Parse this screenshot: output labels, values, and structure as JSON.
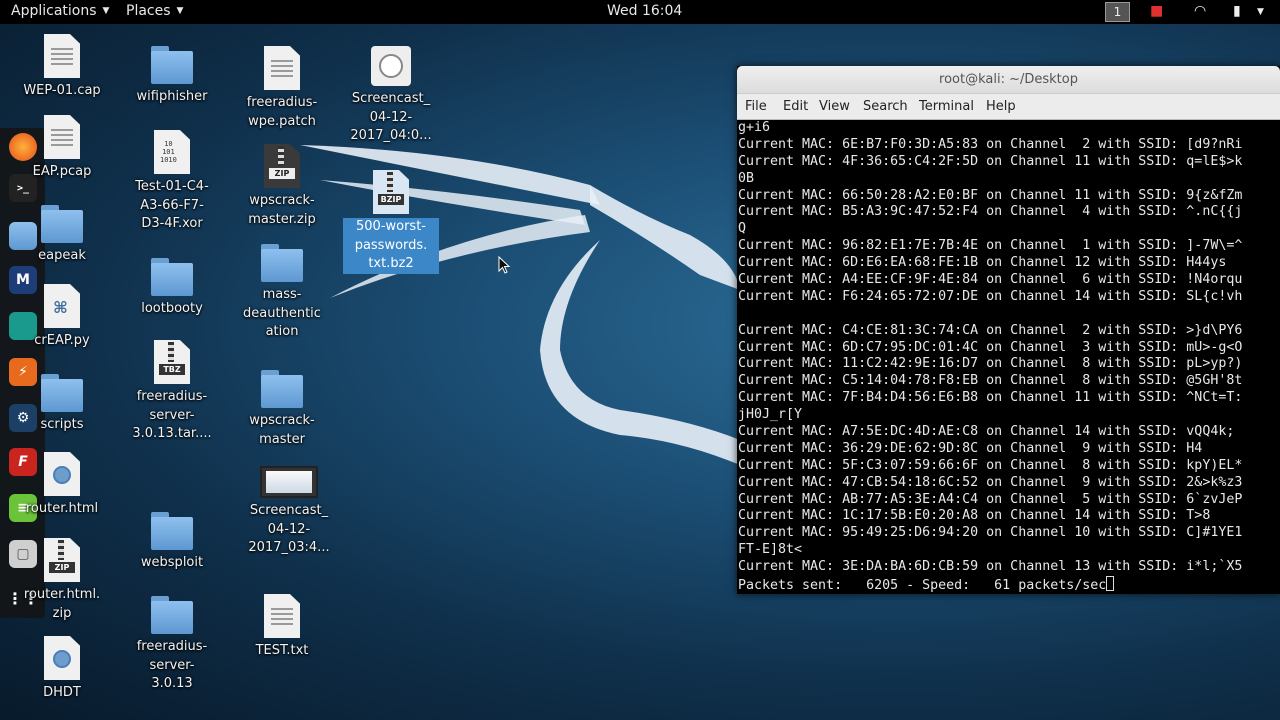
{
  "topbar": {
    "applications": "Applications",
    "places": "Places",
    "clock": "Wed 16:04",
    "workspace": "1"
  },
  "desktop_icons": [
    {
      "name": "wep01",
      "label": "WEP-01.cap"
    },
    {
      "name": "wifiphisher",
      "label": "wifiphisher"
    },
    {
      "name": "freeradius-patch",
      "label": "freeradius-\nwpe.patch"
    },
    {
      "name": "screencast1",
      "label": "Screencast_\n04-12-\n2017_04:0..."
    },
    {
      "name": "eap-pcap",
      "label": "EAP.pcap"
    },
    {
      "name": "test-xor",
      "label": "Test-01-C4-\nA3-66-F7-\nD3-4F.xor"
    },
    {
      "name": "wpscrack-zip",
      "label": "wpscrack-\nmaster.zip"
    },
    {
      "name": "passwords-bz2",
      "label": "500-worst-\npasswords.\ntxt.bz2"
    },
    {
      "name": "eapeak",
      "label": "eapeak"
    },
    {
      "name": "lootbooty",
      "label": "lootbooty"
    },
    {
      "name": "mass-deauth",
      "label": "mass-\ndeauthentic\nation"
    },
    {
      "name": "crEAP",
      "label": "crEAP.py"
    },
    {
      "name": "freeradius-tar",
      "label": "freeradius-\nserver-\n3.0.13.tar...."
    },
    {
      "name": "scripts",
      "label": "scripts"
    },
    {
      "name": "wpscrack-master",
      "label": "wpscrack-\nmaster"
    },
    {
      "name": "router-html",
      "label": "router.html"
    },
    {
      "name": "screencast2",
      "label": "Screencast_\n04-12-\n2017_03:4..."
    },
    {
      "name": "websploit",
      "label": "websploit"
    },
    {
      "name": "router-zip",
      "label": "router.html.\nzip"
    },
    {
      "name": "freeradius-server",
      "label": "freeradius-\nserver-\n3.0.13"
    },
    {
      "name": "test-txt",
      "label": "TEST.txt"
    },
    {
      "name": "dhdt",
      "label": "DHDT"
    }
  ],
  "terminal": {
    "title": "root@kali: ~/Desktop",
    "menu": [
      "File",
      "Edit",
      "View",
      "Search",
      "Terminal",
      "Help"
    ],
    "lines": [
      "g+i6",
      "Current MAC: 6E:B7:F0:3D:A5:83 on Channel  2 with SSID: [d9?nRi",
      "Current MAC: 4F:36:65:C4:2F:5D on Channel 11 with SSID: q=lE$>k",
      "0B",
      "Current MAC: 66:50:28:A2:E0:BF on Channel 11 with SSID: 9{z&fZm",
      "Current MAC: B5:A3:9C:47:52:F4 on Channel  4 with SSID: ^.nC{{j",
      "Q",
      "Current MAC: 96:82:E1:7E:7B:4E on Channel  1 with SSID: ]-7W\\=^",
      "Current MAC: 6D:E6:EA:68:FE:1B on Channel 12 with SSID: H44ys",
      "Current MAC: A4:EE:CF:9F:4E:84 on Channel  6 with SSID: !N4orqu",
      "Current MAC: F6:24:65:72:07:DE on Channel 14 with SSID: SL{c!vh",
      "",
      "Current MAC: C4:CE:81:3C:74:CA on Channel  2 with SSID: >}d\\PY6",
      "Current MAC: 6D:C7:95:DC:01:4C on Channel  3 with SSID: mU>-g<O",
      "Current MAC: 11:C2:42:9E:16:D7 on Channel  8 with SSID: pL>yp?)",
      "Current MAC: C5:14:04:78:F8:EB on Channel  8 with SSID: @5GH'8t",
      "Current MAC: 7F:B4:D4:56:E6:B8 on Channel 11 with SSID: ^NCt=T:",
      "jH0J_r[Y",
      "Current MAC: A7:5E:DC:4D:AE:C8 on Channel 14 with SSID: vQQ4k; ",
      "Current MAC: 36:29:DE:62:9D:8C on Channel  9 with SSID: H4",
      "Current MAC: 5F:C3:07:59:66:6F on Channel  8 with SSID: kpY)EL*",
      "Current MAC: 47:CB:54:18:6C:52 on Channel  9 with SSID: 2&>k%z3",
      "Current MAC: AB:77:A5:3E:A4:C4 on Channel  5 with SSID: 6`zvJeP",
      "Current MAC: 1C:17:5B:E0:20:A8 on Channel 14 with SSID: T>8",
      "Current MAC: 95:49:25:D6:94:20 on Channel 10 with SSID: C]#1YE1",
      "FT-E]8t<",
      "Current MAC: 3E:DA:BA:6D:CB:59 on Channel 13 with SSID: i*l;`X5",
      "Packets sent:   6205 - Speed:   61 packets/sec"
    ]
  },
  "colors": {
    "desktop_bg": "#1b4d73",
    "selection": "#3b87c7",
    "terminal_bg": "#000000",
    "terminal_fg": "#e8e8e8"
  },
  "dock_icons": [
    "firefox-icon",
    "terminal-icon",
    "files-icon",
    "metasploit-icon",
    "armitage-icon",
    "burpsuite-icon",
    "maltego-icon",
    "faraday-icon",
    "leafpad-icon",
    "cherrytree-icon",
    "show-apps-icon"
  ]
}
